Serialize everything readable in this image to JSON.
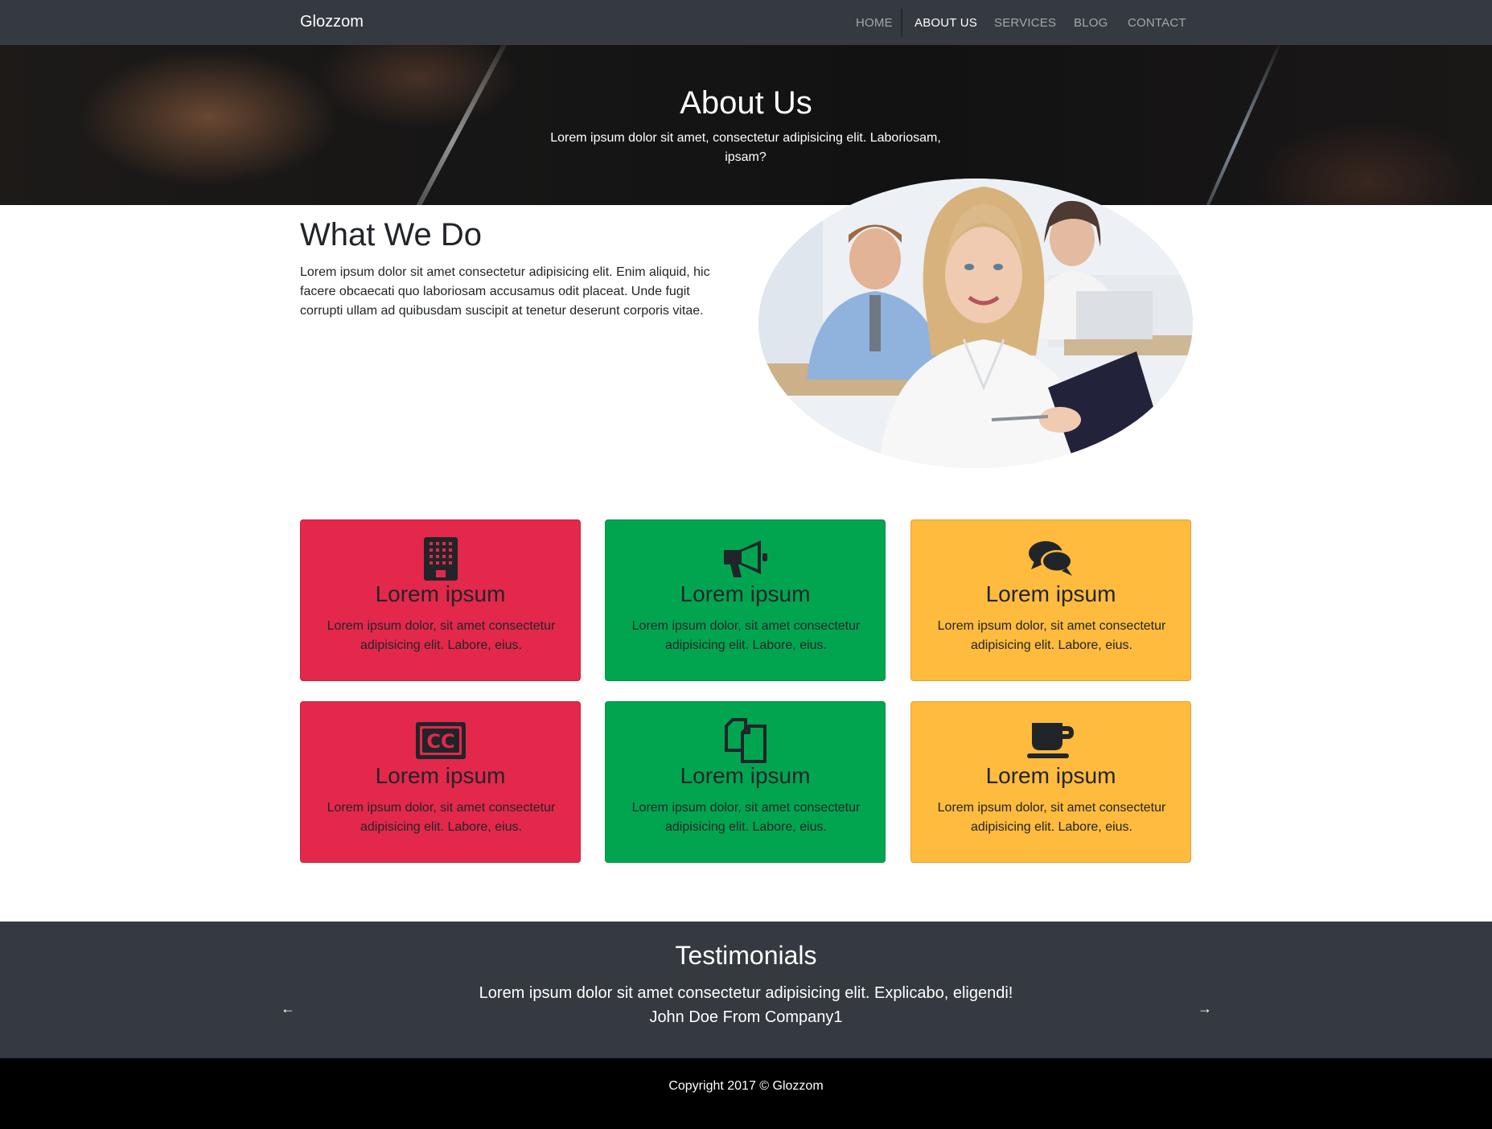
{
  "navbar": {
    "brand": "Glozzom",
    "items": [
      {
        "label": "HOME",
        "active": false
      },
      {
        "label": "ABOUT US",
        "active": true
      },
      {
        "label": "SERVICES",
        "active": false
      },
      {
        "label": "BLOG",
        "active": false
      },
      {
        "label": "CONTACT",
        "active": false
      }
    ]
  },
  "hero": {
    "title": "About Us",
    "subtitle": "Lorem ipsum dolor sit amet, consectetur adipisicing elit. Laboriosam, ipsam?"
  },
  "what_we_do": {
    "title": "What We Do",
    "text": "Lorem ipsum dolor sit amet consectetur adipisicing elit. Enim aliquid, hic facere obcaecati quo laboriosam accusamus odit placeat. Unde fugit corrupti ullam ad quibusdam suscipit at tenetur deserunt corporis vitae."
  },
  "colors": {
    "red": "#e3284b",
    "green": "#01a550",
    "yellow": "#febb3d",
    "dark": "#343a40",
    "icon": "#212529"
  },
  "cards": [
    {
      "icon": "building-icon",
      "title": "Lorem ipsum",
      "text": "Lorem ipsum dolor, sit amet consectetur adipisicing elit. Labore, eius.",
      "color": "red"
    },
    {
      "icon": "bullhorn-icon",
      "title": "Lorem ipsum",
      "text": "Lorem ipsum dolor, sit amet consectetur adipisicing elit. Labore, eius.",
      "color": "green"
    },
    {
      "icon": "comments-icon",
      "title": "Lorem ipsum",
      "text": "Lorem ipsum dolor, sit amet consectetur adipisicing elit. Labore, eius.",
      "color": "yellow"
    },
    {
      "icon": "closed-captioning-icon",
      "title": "Lorem ipsum",
      "text": "Lorem ipsum dolor, sit amet consectetur adipisicing elit. Labore, eius.",
      "color": "red"
    },
    {
      "icon": "copy-icon",
      "title": "Lorem ipsum",
      "text": "Lorem ipsum dolor, sit amet consectetur adipisicing elit. Labore, eius.",
      "color": "green"
    },
    {
      "icon": "coffee-icon",
      "title": "Lorem ipsum",
      "text": "Lorem ipsum dolor, sit amet consectetur adipisicing elit. Labore, eius.",
      "color": "yellow"
    }
  ],
  "testimonials": {
    "title": "Testimonials",
    "quote": "Lorem ipsum dolor sit amet consectetur adipisicing elit. Explicabo, eligendi!",
    "author": "John Doe From Company1",
    "prev": "←",
    "next": "→"
  },
  "footer": {
    "copyright": "Copyright 2017 © Glozzom"
  }
}
